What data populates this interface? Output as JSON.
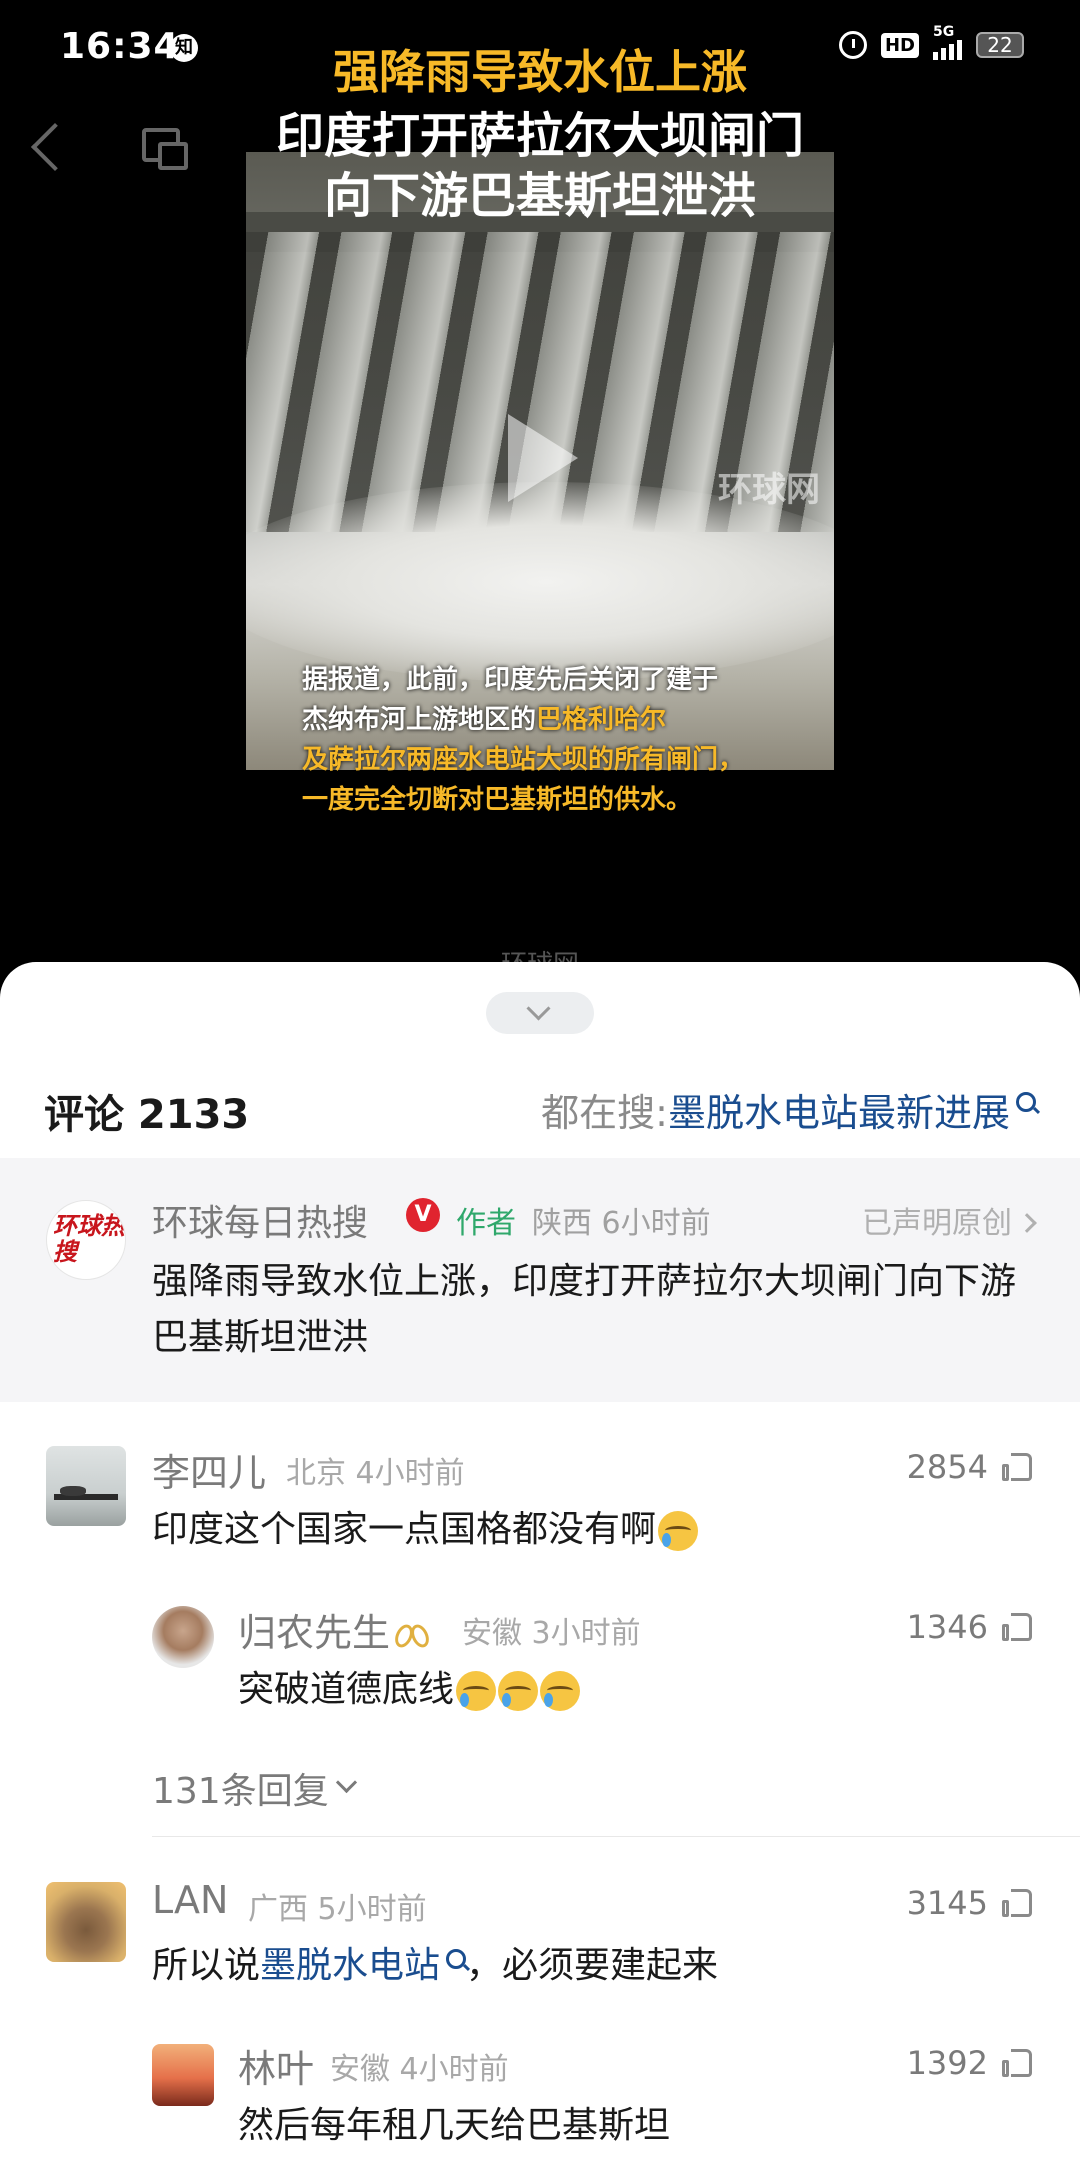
{
  "status_bar": {
    "time": "16:34",
    "app_badge": "知",
    "hd": "HD",
    "network": "5G",
    "battery": "22"
  },
  "video": {
    "title_line1": "强降雨导致水位上涨",
    "title_line2": "印度打开萨拉尔大坝闸门",
    "title_line3": "向下游巴基斯坦泄洪",
    "watermark": "环球网",
    "caption_line1": "据报道，此前，印度先后关闭了建于",
    "caption_line2a": "杰纳布河上游地区的",
    "caption_line2b": "巴格利哈尔",
    "caption_line3": "及萨拉尔两座水电站大坝的所有闸门，",
    "caption_line4": "一度完全切断对巴基斯坦的供水。",
    "bottom_watermark": "环球网"
  },
  "sheet": {
    "comment_count_label": "评论 2133",
    "hot_search_label": "都在搜: ",
    "hot_search_link": "墨脱水电站最新进展"
  },
  "author_post": {
    "avatar_text": "环球热搜",
    "name": "环球每日热搜",
    "verified": "V",
    "tag": "作者",
    "meta": "陕西 6小时前",
    "original_link": "已声明原创",
    "text": "强降雨导致水位上涨，印度打开萨拉尔大坝闸门向下游巴基斯坦泄洪"
  },
  "comments": [
    {
      "name": "李四儿",
      "meta": "北京 4小时前",
      "likes": "2854",
      "text": "印度这个国家一点国格都没有啊"
    },
    {
      "name": "归农先生",
      "meta": "安徽 3小时前",
      "likes": "1346",
      "text": "突破道德底线"
    },
    {
      "replies": "131条回复"
    },
    {
      "name": "LAN",
      "meta": "广西 5小时前",
      "likes": "3145",
      "text_pre": "所以说",
      "text_link": "墨脱水电站",
      "text_post": "，必须要建起来"
    },
    {
      "name": "林叶",
      "meta": "安徽 4小时前",
      "likes": "1392",
      "text": "然后每年租几天给巴基斯坦"
    }
  ],
  "colors": {
    "accent_gold": "#f7b928",
    "link_blue": "#1a4d8f",
    "author_green": "#2fa86b",
    "verified_red": "#e0242f"
  }
}
